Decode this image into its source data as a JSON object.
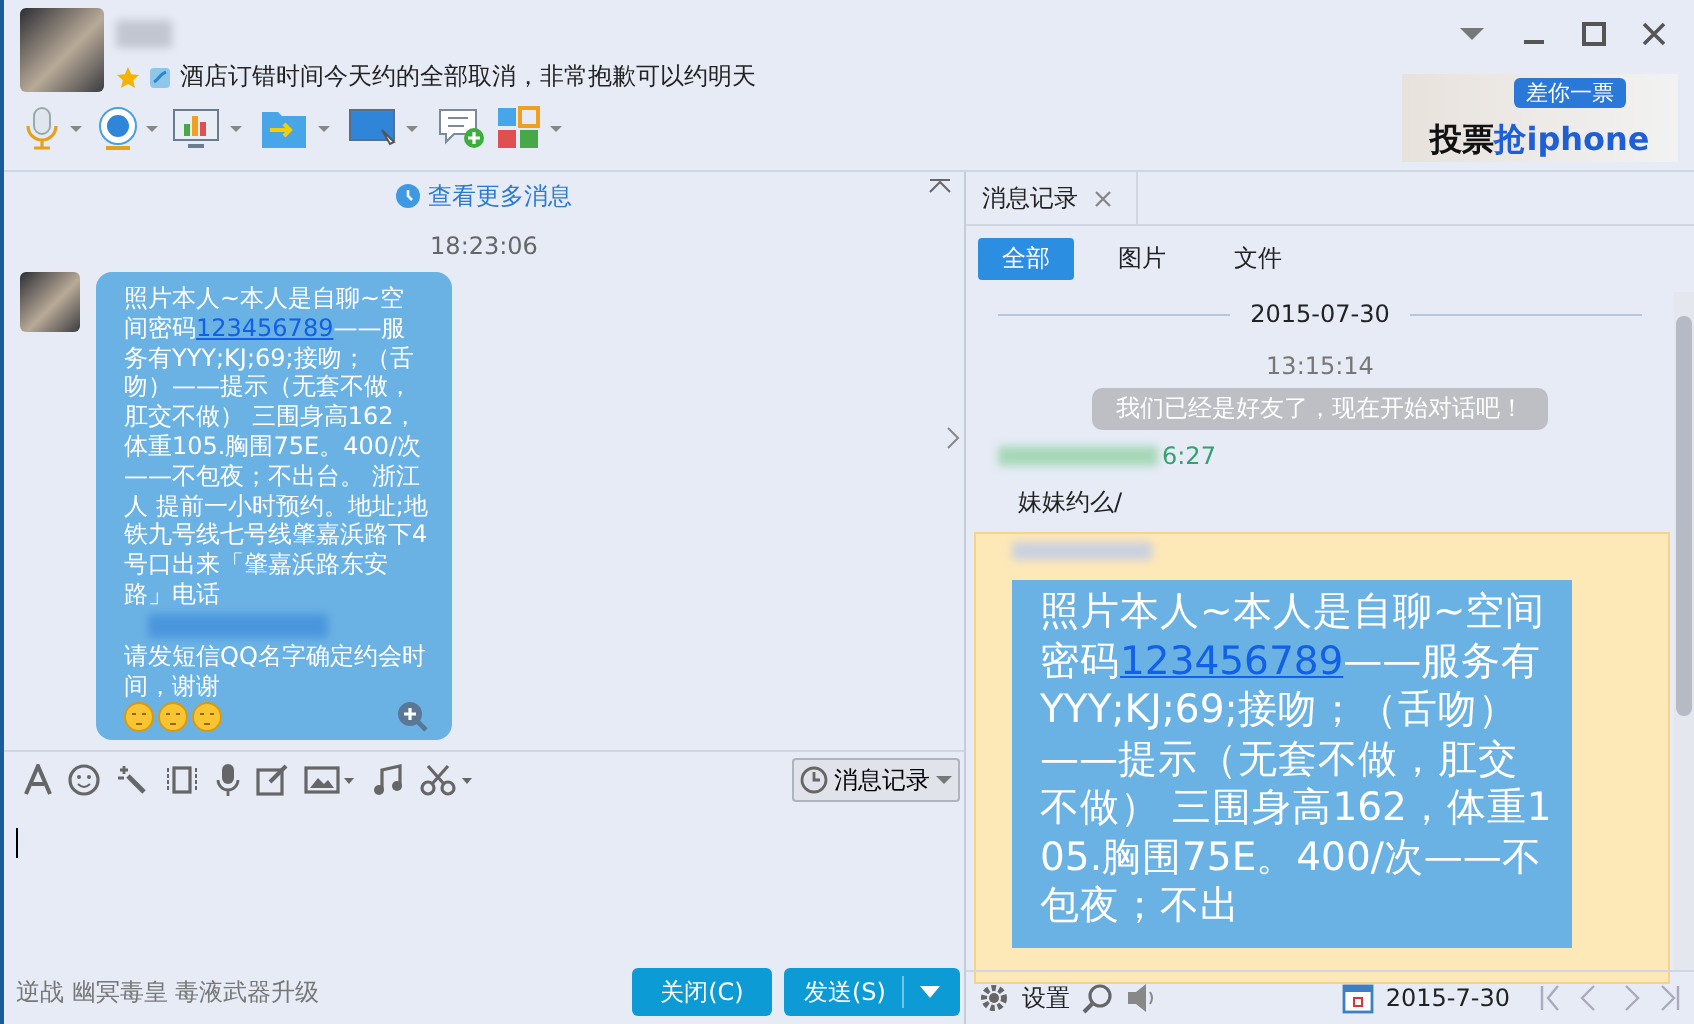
{
  "contact": {
    "status": "酒店订错时间今天约的全部取消，非常抱歉可以约明天"
  },
  "ad": {
    "badge": "差你一票",
    "headline": "投票",
    "headline_highlight": "抢iphone"
  },
  "chat": {
    "more_link": "查看更多消息",
    "time": "18:23:06",
    "message": {
      "before": "照片本人~本人是自聊~空间密码",
      "link": "123456789",
      "after": "——服务有YYY;KJ;69;接吻；（舌吻）——提示（无套不做，肛交不做） 三围身高162，体重105.胸围75E。400/次——不包夜；不出台。 浙江人 提前一小时预约。地址;地铁九号线七号线肇嘉浜路下4号口出来「肇嘉浜路东安路」电话",
      "end": "请发短信QQ名字确定约会时间，谢谢"
    }
  },
  "input": {
    "history_button": "消息记录"
  },
  "status_text": "逆战 幽冥毒皇 毒液武器升级",
  "buttons": {
    "close": "关闭(C)",
    "send": "发送(S)"
  },
  "history": {
    "tab_title": "消息记录",
    "filters": [
      {
        "label": "全部",
        "selected": true
      },
      {
        "label": "图片",
        "selected": false
      },
      {
        "label": "文件",
        "selected": false
      }
    ],
    "date": "2015-07-30",
    "time": "13:15:14",
    "system_message": "我们已经是好友了，现在开始对话吧！",
    "sender_time": "6:27",
    "first_message": "妹妹约么/",
    "message": {
      "before": "照片本人~本人是自聊~空间密码",
      "link": "123456789",
      "after": "——服务有YYY;KJ;69;接吻；（舌吻）——提示（无套不做，肛交不做） 三围身高162，体重105.胸围75E。400/次——不包夜；不出"
    },
    "footer": {
      "settings": "设置",
      "date": "2015-7-30"
    }
  }
}
